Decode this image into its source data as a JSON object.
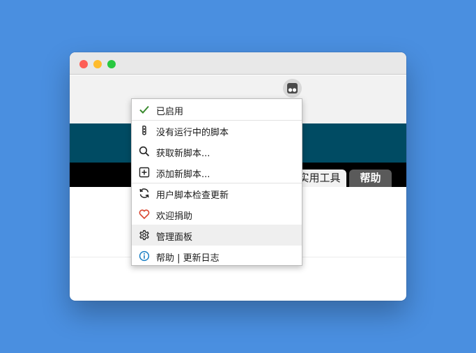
{
  "browser": {
    "window_controls": [
      "close",
      "minimize",
      "maximize"
    ],
    "extension_icon": "tampermonkey-icon"
  },
  "page": {
    "tabs": [
      {
        "label": "实用工具"
      },
      {
        "label": "帮助"
      }
    ]
  },
  "menu": {
    "items": [
      {
        "label": "已启用",
        "icon": "check-icon",
        "color": "#3a8a2e"
      },
      {
        "label": "没有运行中的脚本",
        "icon": "script-icon"
      },
      {
        "label": "获取新脚本...",
        "icon": "search-icon"
      },
      {
        "label": "添加新脚本...",
        "icon": "plus-square-icon"
      },
      {
        "label": "用户脚本检查更新",
        "icon": "refresh-icon"
      },
      {
        "label": "欢迎捐助",
        "icon": "heart-icon",
        "color": "#d9442e"
      },
      {
        "label": "管理面板",
        "icon": "gear-icon"
      },
      {
        "label": "帮助 | 更新日志",
        "icon": "info-icon",
        "color": "#1a7fc4"
      }
    ]
  },
  "colors": {
    "desktop": "#4a8fe0",
    "header_band": "#004b63",
    "nav_band": "#000000",
    "active_tab": "#5a5a5a"
  }
}
